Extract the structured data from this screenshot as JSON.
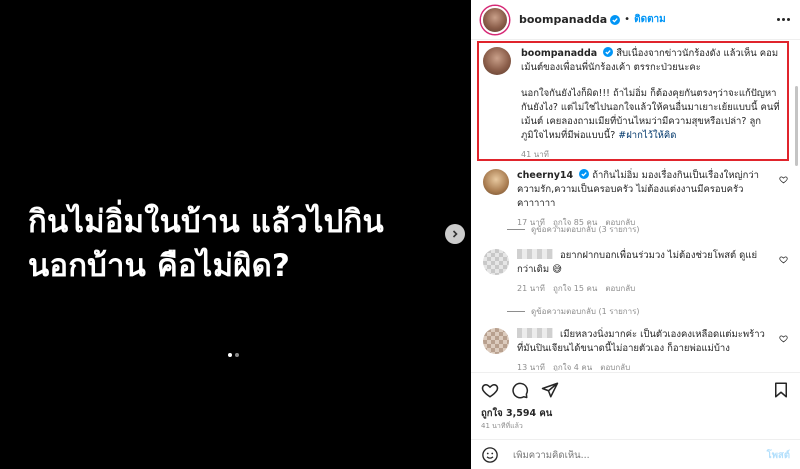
{
  "media": {
    "caption_line1": "กินไม่อิ่มในบ้าน แล้วไปกิน",
    "caption_line2": "นอกบ้าน คือไม่ผิด?"
  },
  "header": {
    "username": "boompanadda",
    "follow_label": "ติดตาม"
  },
  "caption": {
    "username": "boompanadda",
    "text1": "สืบเนื่องจากข่าวนักร้องดัง แล้วเห็น คอมเม้นต์ของเพื่อนพี่นักร้องเค้า ตรรกะป่วยนะคะ",
    "text2": "นอกใจกันยังไงก็ผิด!!! ถ้าไม่อิ่ม ก็ต้องคุยกันตรงๆว่าจะแก้ปัญหากันยังไง? แต่ไม่ใช่ไปนอกใจแล้วให้คนอื่นมาเยาะเย้ยแบบนี้ คนที่เม้นต์ เคยลองถามเมียที่บ้านไหมว่ามีความสุขหรือเปล่า? ลูกภูมิใจไหมที่มีพ่อแบบนี้?",
    "hashtag": "#ฝากไว้ให้คิด",
    "time": "41 นาที"
  },
  "comments": [
    {
      "username": "cheerny14",
      "text": "ถ้ากินไม่อิ่ม มองเรื่องกินเป็นเรื่องใหญ่กว่าความรัก,ความเป็นครอบครัว ไม่ต้องแต่งงานมีครอบครัวคาาาาาา",
      "time": "17 นาที",
      "likes": "ถูกใจ 85 คน",
      "reply": "ตอบกลับ",
      "view_replies": "ดูข้อความตอบกลับ (3 รายการ)"
    },
    {
      "username": "",
      "text": "อยากฝากบอกเพื่อนร่วมวง ไม่ต้องช่วยโพสต์ ดูแย่กว่าเดิม",
      "emoji": "😅",
      "time": "21 นาที",
      "likes": "ถูกใจ 15 คน",
      "reply": "ตอบกลับ",
      "view_replies": "ดูข้อความตอบกลับ (1 รายการ)"
    },
    {
      "username": "",
      "text": "เมียหลวงนิ่งมากค่ะ เป็นตัวเองคงเหลือดแต่มะพร้าวที่มันปินเจียนได้ขนาดนี้ไม่อายตัวเอง ก็อายพ่อแม่บ้าง",
      "time": "13 นาที",
      "likes": "ถูกใจ 4 คน",
      "reply": "ตอบกลับ"
    }
  ],
  "actions": {
    "likes": "ถูกใจ 3,594 คน",
    "time": "41 นาทีที่แล้ว",
    "add_comment_placeholder": "เพิ่มความคิดเห็น...",
    "post_label": "โพสต์"
  },
  "colors": {
    "accent": "#0095f6",
    "highlight_border": "#e0242c"
  }
}
